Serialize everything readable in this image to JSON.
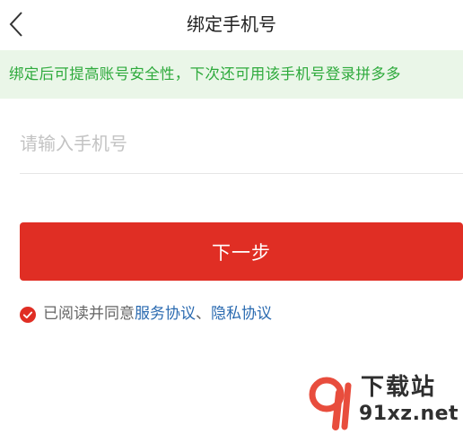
{
  "nav": {
    "title": "绑定手机号",
    "back_icon": "chevron-left-icon"
  },
  "notice": {
    "text": "绑定后可提高账号安全性，下次还可用该手机号登录拼多多"
  },
  "form": {
    "phone_placeholder": "请输入手机号",
    "phone_value": "",
    "next_label": "下一步"
  },
  "agreement": {
    "checked": true,
    "prefix": "已阅读并同意",
    "link1": "服务协议",
    "separator": "、",
    "link2": "隐私协议"
  },
  "watermark": {
    "text": "下载站",
    "url": "91xz.net"
  },
  "colors": {
    "accent": "#e02e24",
    "notice_bg": "#eaf6e8",
    "notice_text": "#2eaa3c",
    "link": "#2a6ab0"
  }
}
